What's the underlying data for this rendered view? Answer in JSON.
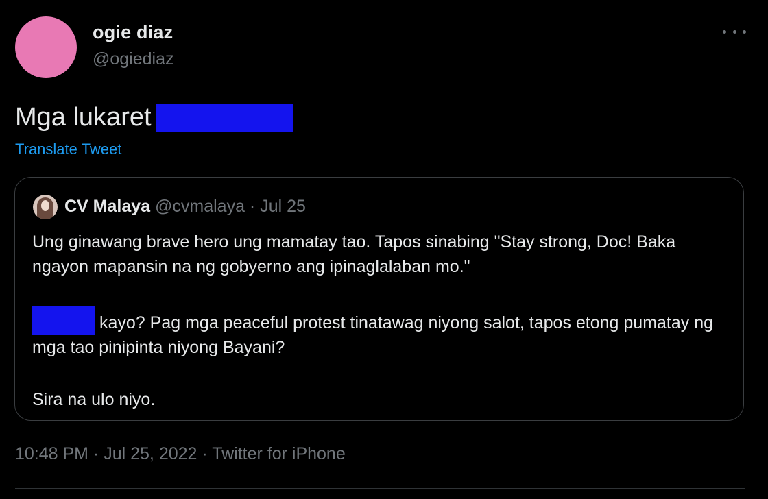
{
  "user": {
    "display_name": "ogie diaz",
    "handle": "@ogiediaz"
  },
  "tweet": {
    "text": "Mga lukaret",
    "translate_label": "Translate Tweet",
    "timestamp": "10:48 PM · Jul 25, 2022 · Twitter for iPhone"
  },
  "quote": {
    "author_name": "CV Malaya",
    "author_handle_date": " @cvmalaya · Jul 25",
    "para1": "Ung ginawang brave hero ung mamatay tao. Tapos sinabing \"Stay strong, Doc! Baka ngayon mapansin na ng gobyerno ang ipinaglalaban mo.\"",
    "para2": "kayo? Pag mga peaceful protest tinatawag niyong salot, tapos etong pumatay ng mga tao pinipinta niyong Bayani?",
    "para3": "Sira na ulo niyo."
  },
  "icons": {
    "more": "more-horizontal-icon",
    "redaction": "redaction-box"
  },
  "colors": {
    "background": "#000000",
    "text": "#e7e9ea",
    "muted": "#71767b",
    "link": "#1d9bf0",
    "avatar": "#e879b4",
    "redaction": "#1414ee"
  }
}
